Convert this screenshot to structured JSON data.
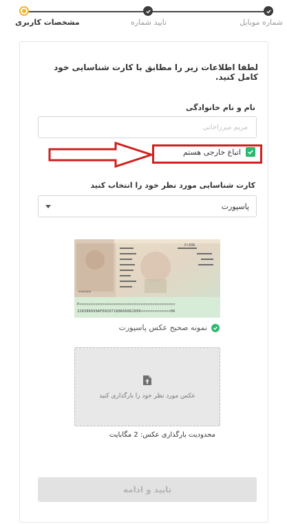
{
  "stepper": {
    "steps": [
      {
        "label": "شماره موبایل",
        "state": "done"
      },
      {
        "label": "تایید شماره",
        "state": "done"
      },
      {
        "label": "مشخصات کاربری",
        "state": "active"
      }
    ],
    "colors": {
      "done": "#3b3b3b",
      "active": "#f0b429"
    }
  },
  "form": {
    "intro": "لطفا اطلاعات زیر را مطابق با کارت شناسایی خود کامل کنید.",
    "name_label": "نام و نام خانوادگی",
    "name_placeholder": "مریم میرزاخانی",
    "foreign_checkbox_label": "اتباع خارجی هستم",
    "foreign_checked": true,
    "id_card_label": "کارت شناسایی مورد نظر خود را انتخاب کنید",
    "id_card_selected": "پاسپورت",
    "sample_caption": "نمونه صحیح عکس پاسپورت",
    "upload_text": "عکس مورد نظر خود را بارگذاری کنید",
    "size_note": "محدودیت بارگذاری عکس: 2 مگابایت",
    "submit_label": "تایید و ادامه"
  },
  "passport": {
    "header_code": "P<IRN",
    "mrz_line_1": "P<<<<<<<<<<<<<<<<<<<<<<<<<<<<<<<<<<<<<<<<<<",
    "mrz_line_2": "228386699AF60207188666062999<<<<<<<<<<<<<06"
  },
  "colors": {
    "check": "#2eb872",
    "annotation": "#d11f1f",
    "disabled_button": "#e2e2e2"
  }
}
